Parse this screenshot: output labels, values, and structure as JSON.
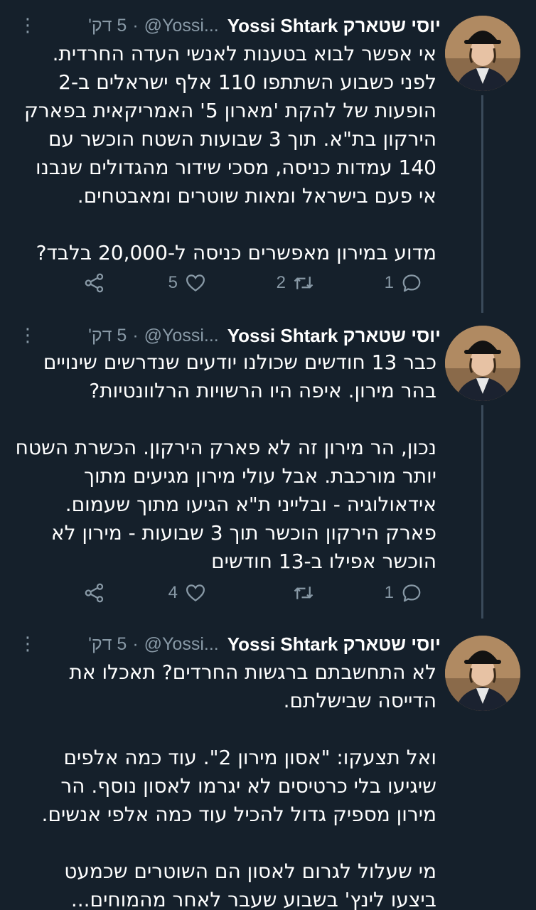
{
  "tweets": [
    {
      "name": "יוסי שטארק Yossi Shtark",
      "handle": "@Yossi...",
      "separator": "·",
      "time": "5 דק'",
      "more": "⋮",
      "paragraphs": [
        [
          "אי אפשר לבוא בטענות לאנשי העדה החרדית.",
          "לפני כשבוע השתתפו 110 אלף ישראלים ב-2",
          "הופעות של להקת 'מארון 5' האמריקאית בפארק",
          "הירקון בת\"א. תוך 3 שבועות השטח הוכשר עם",
          "140 עמדות כניסה, מסכי שידור מהגדולים שנבנו",
          "אי פעם בישראל ומאות שוטרים ומאבטחים."
        ],
        [
          "מדוע במירון מאפשרים כניסה ל-20,000 בלבד?"
        ]
      ],
      "actions": {
        "reply_count": "1",
        "retweet_count": "2",
        "like_count": "5"
      }
    },
    {
      "name": "יוסי שטארק Yossi Shtark",
      "handle": "@Yossi...",
      "separator": "·",
      "time": "5 דק'",
      "more": "⋮",
      "paragraphs": [
        [
          "כבר 13 חודשים שכולנו יודעים שנדרשים שינויים",
          "בהר מירון. איפה היו הרשויות הרלוונטיות?"
        ],
        [
          "נכון, הר מירון זה לא פארק הירקון. הכשרת השטח",
          "יותר מורכבת. אבל עולי מירון מגיעים מתוך",
          "אידאולוגיה - ובלייני ת\"א הגיעו מתוך שעמום.",
          "פארק הירקון הוכשר תוך 3 שבועות - מירון לא",
          "הוכשר אפילו ב-13 חודשים"
        ]
      ],
      "actions": {
        "reply_count": "1",
        "retweet_count": "",
        "like_count": "4"
      }
    },
    {
      "name": "יוסי שטארק Yossi Shtark",
      "handle": "@Yossi...",
      "separator": "·",
      "time": "5 דק'",
      "more": "⋮",
      "paragraphs": [
        [
          "לא התחשבתם ברגשות החרדים? תאכלו את",
          "הדייסה שבישלתם."
        ],
        [
          "ואל תצעקו: \"אסון מירון 2\". עוד כמה אלפים",
          "שיגיעו בלי כרטיסים לא יגרמו לאסון נוסף. הר",
          "מירון מספיק גדול להכיל עוד כמה אלפי אנשים."
        ],
        [
          "מי שעלול לגרום לאסון הם השוטרים שכמעט",
          "ביצעו לינץ' בשבוע שעבר לאחר מהמוחים..."
        ]
      ]
    }
  ]
}
